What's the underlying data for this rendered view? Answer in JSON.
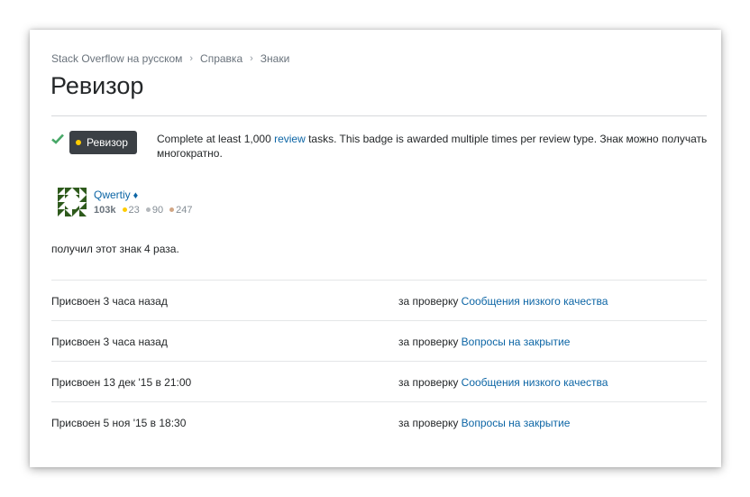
{
  "breadcrumb": [
    "Stack Overflow на русском",
    "Справка",
    "Знаки"
  ],
  "page_title": "Ревизор",
  "badge": {
    "name": "Ревизор",
    "desc_before": "Complete at least 1,000 ",
    "desc_link": "review",
    "desc_after": " tasks. This badge is awarded multiple times per review type. Знак можно получать многократно."
  },
  "user": {
    "name": "Qwertiy",
    "moderator_mark": "♦",
    "reputation": "103k",
    "gold": "23",
    "silver": "90",
    "bronze": "247"
  },
  "received_text": "получил этот знак 4 раза.",
  "awards": [
    {
      "date": "Присвоен 3 часа назад",
      "for_prefix": "за проверку",
      "queue": "Сообщения низкого качества"
    },
    {
      "date": "Присвоен 3 часа назад",
      "for_prefix": "за проверку",
      "queue": "Вопросы на закрытие"
    },
    {
      "date": "Присвоен 13 дек '15 в 21:00",
      "for_prefix": "за проверку",
      "queue": "Сообщения низкого качества"
    },
    {
      "date": "Присвоен 5 ноя '15 в 18:30",
      "for_prefix": "за проверку",
      "queue": "Вопросы на закрытие"
    }
  ],
  "colors": {
    "link": "#0c65a5",
    "badge_bg": "#3b4045",
    "gold": "#ffcc01",
    "silver": "#b4b8bc",
    "bronze": "#d1a684",
    "check": "#48a868"
  },
  "icons": {
    "check": "check-icon",
    "breadcrumb_separator": "chevron-right-icon"
  }
}
